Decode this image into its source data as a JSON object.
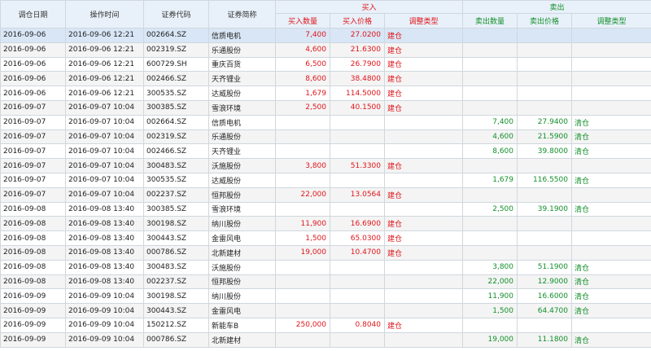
{
  "header": {
    "adjust_date": "调仓日期",
    "op_time": "操作时间",
    "code": "证券代码",
    "name": "证券简称",
    "buy_group": "买入",
    "sell_group": "卖出",
    "buy_qty": "买入数量",
    "buy_price": "买入价格",
    "buy_type": "调整类型",
    "sell_qty": "卖出数量",
    "sell_price": "卖出价格",
    "sell_type": "调整类型"
  },
  "rows": [
    {
      "date": "2016-09-06",
      "time": "2016-09-06 12:21",
      "code": "002664.SZ",
      "name": "信质电机",
      "buy_qty": "7,400",
      "buy_price": "27.0200",
      "buy_type": "建仓",
      "sell_qty": "",
      "sell_price": "",
      "sell_type": ""
    },
    {
      "date": "2016-09-06",
      "time": "2016-09-06 12:21",
      "code": "002319.SZ",
      "name": "乐通股份",
      "buy_qty": "4,600",
      "buy_price": "21.6300",
      "buy_type": "建仓",
      "sell_qty": "",
      "sell_price": "",
      "sell_type": ""
    },
    {
      "date": "2016-09-06",
      "time": "2016-09-06 12:21",
      "code": "600729.SH",
      "name": "重庆百货",
      "buy_qty": "6,500",
      "buy_price": "26.7900",
      "buy_type": "建仓",
      "sell_qty": "",
      "sell_price": "",
      "sell_type": ""
    },
    {
      "date": "2016-09-06",
      "time": "2016-09-06 12:21",
      "code": "002466.SZ",
      "name": "天齐锂业",
      "buy_qty": "8,600",
      "buy_price": "38.4800",
      "buy_type": "建仓",
      "sell_qty": "",
      "sell_price": "",
      "sell_type": ""
    },
    {
      "date": "2016-09-06",
      "time": "2016-09-06 12:21",
      "code": "300535.SZ",
      "name": "达威股份",
      "buy_qty": "1,679",
      "buy_price": "114.5000",
      "buy_type": "建仓",
      "sell_qty": "",
      "sell_price": "",
      "sell_type": ""
    },
    {
      "date": "2016-09-07",
      "time": "2016-09-07 10:04",
      "code": "300385.SZ",
      "name": "雪浪环境",
      "buy_qty": "2,500",
      "buy_price": "40.1500",
      "buy_type": "建仓",
      "sell_qty": "",
      "sell_price": "",
      "sell_type": ""
    },
    {
      "date": "2016-09-07",
      "time": "2016-09-07 10:04",
      "code": "002664.SZ",
      "name": "信质电机",
      "buy_qty": "",
      "buy_price": "",
      "buy_type": "",
      "sell_qty": "7,400",
      "sell_price": "27.9400",
      "sell_type": "清仓"
    },
    {
      "date": "2016-09-07",
      "time": "2016-09-07 10:04",
      "code": "002319.SZ",
      "name": "乐通股份",
      "buy_qty": "",
      "buy_price": "",
      "buy_type": "",
      "sell_qty": "4,600",
      "sell_price": "21.5900",
      "sell_type": "清仓"
    },
    {
      "date": "2016-09-07",
      "time": "2016-09-07 10:04",
      "code": "002466.SZ",
      "name": "天齐锂业",
      "buy_qty": "",
      "buy_price": "",
      "buy_type": "",
      "sell_qty": "8,600",
      "sell_price": "39.8000",
      "sell_type": "清仓"
    },
    {
      "date": "2016-09-07",
      "time": "2016-09-07 10:04",
      "code": "300483.SZ",
      "name": "沃施股份",
      "buy_qty": "3,800",
      "buy_price": "51.3300",
      "buy_type": "建仓",
      "sell_qty": "",
      "sell_price": "",
      "sell_type": ""
    },
    {
      "date": "2016-09-07",
      "time": "2016-09-07 10:04",
      "code": "300535.SZ",
      "name": "达威股份",
      "buy_qty": "",
      "buy_price": "",
      "buy_type": "",
      "sell_qty": "1,679",
      "sell_price": "116.5500",
      "sell_type": "清仓"
    },
    {
      "date": "2016-09-07",
      "time": "2016-09-07 10:04",
      "code": "002237.SZ",
      "name": "恒邦股份",
      "buy_qty": "22,000",
      "buy_price": "13.0564",
      "buy_type": "建仓",
      "sell_qty": "",
      "sell_price": "",
      "sell_type": ""
    },
    {
      "date": "2016-09-08",
      "time": "2016-09-08 13:40",
      "code": "300385.SZ",
      "name": "雪浪环境",
      "buy_qty": "",
      "buy_price": "",
      "buy_type": "",
      "sell_qty": "2,500",
      "sell_price": "39.1900",
      "sell_type": "清仓"
    },
    {
      "date": "2016-09-08",
      "time": "2016-09-08 13:40",
      "code": "300198.SZ",
      "name": "纳川股份",
      "buy_qty": "11,900",
      "buy_price": "16.6900",
      "buy_type": "建仓",
      "sell_qty": "",
      "sell_price": "",
      "sell_type": ""
    },
    {
      "date": "2016-09-08",
      "time": "2016-09-08 13:40",
      "code": "300443.SZ",
      "name": "金雷风电",
      "buy_qty": "1,500",
      "buy_price": "65.0300",
      "buy_type": "建仓",
      "sell_qty": "",
      "sell_price": "",
      "sell_type": ""
    },
    {
      "date": "2016-09-08",
      "time": "2016-09-08 13:40",
      "code": "000786.SZ",
      "name": "北新建材",
      "buy_qty": "19,000",
      "buy_price": "10.4700",
      "buy_type": "建仓",
      "sell_qty": "",
      "sell_price": "",
      "sell_type": ""
    },
    {
      "date": "2016-09-08",
      "time": "2016-09-08 13:40",
      "code": "300483.SZ",
      "name": "沃施股份",
      "buy_qty": "",
      "buy_price": "",
      "buy_type": "",
      "sell_qty": "3,800",
      "sell_price": "51.1900",
      "sell_type": "清仓"
    },
    {
      "date": "2016-09-08",
      "time": "2016-09-08 13:40",
      "code": "002237.SZ",
      "name": "恒邦股份",
      "buy_qty": "",
      "buy_price": "",
      "buy_type": "",
      "sell_qty": "22,000",
      "sell_price": "12.9000",
      "sell_type": "清仓"
    },
    {
      "date": "2016-09-09",
      "time": "2016-09-09 10:04",
      "code": "300198.SZ",
      "name": "纳川股份",
      "buy_qty": "",
      "buy_price": "",
      "buy_type": "",
      "sell_qty": "11,900",
      "sell_price": "16.6000",
      "sell_type": "清仓"
    },
    {
      "date": "2016-09-09",
      "time": "2016-09-09 10:04",
      "code": "300443.SZ",
      "name": "金雷风电",
      "buy_qty": "",
      "buy_price": "",
      "buy_type": "",
      "sell_qty": "1,500",
      "sell_price": "64.4700",
      "sell_type": "清仓"
    },
    {
      "date": "2016-09-09",
      "time": "2016-09-09 10:04",
      "code": "150212.SZ",
      "name": "新能车B",
      "buy_qty": "250,000",
      "buy_price": "0.8040",
      "buy_type": "建仓",
      "sell_qty": "",
      "sell_price": "",
      "sell_type": ""
    },
    {
      "date": "2016-09-09",
      "time": "2016-09-09 10:04",
      "code": "000786.SZ",
      "name": "北新建材",
      "buy_qty": "",
      "buy_price": "",
      "buy_type": "",
      "sell_qty": "19,000",
      "sell_price": "11.1800",
      "sell_type": "清仓"
    }
  ],
  "selected_row": 0,
  "colors": {
    "buy": "#e0161b",
    "sell": "#12902a",
    "header_bg": "#e8f0f9",
    "selected_bg": "#d8e6f6"
  }
}
